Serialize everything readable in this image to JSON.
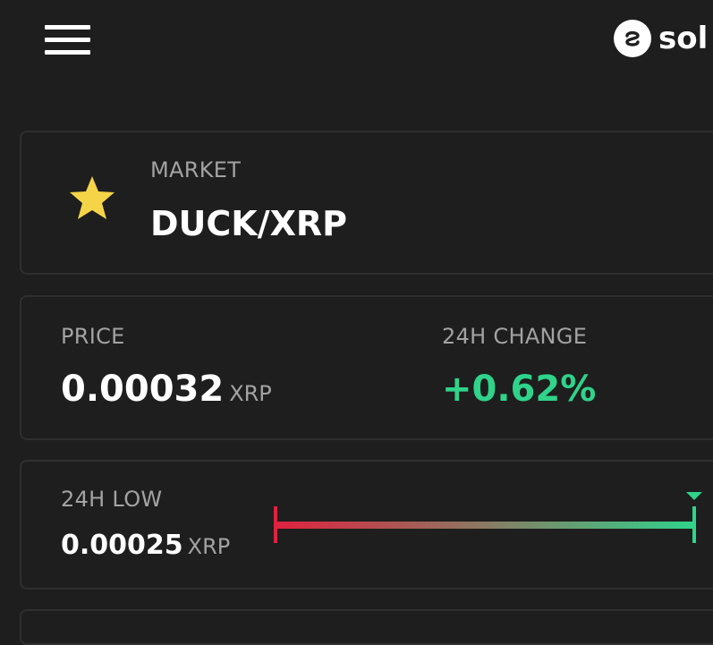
{
  "header": {
    "brand_name": "sol",
    "menu_icon": "hamburger-menu-icon",
    "logo_icon": "sologenic-logo-icon"
  },
  "market_card": {
    "favorite_icon": "star-icon",
    "favorite_color": "#f5d547",
    "label": "MARKET",
    "market_name": "DUCK/XRP"
  },
  "price_card": {
    "price_label": "PRICE",
    "price_value": "0.00032",
    "price_unit": "XRP",
    "change_label": "24H CHANGE",
    "change_value": "+0.62%",
    "change_color": "#2fd38a"
  },
  "range_card": {
    "low_label": "24H LOW",
    "low_value": "0.00025",
    "low_unit": "XRP",
    "current_position_fraction": 1.0,
    "low_color": "#e0213f",
    "high_color": "#2fd38a",
    "marker_icon": "triangle-down-marker-icon"
  }
}
